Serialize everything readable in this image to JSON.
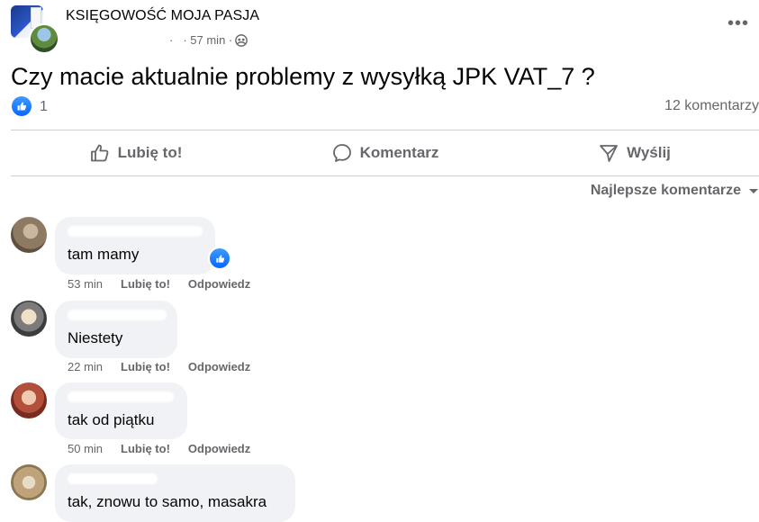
{
  "post": {
    "group_name": "KSIĘGOWOŚĆ MOJA PASJA",
    "author_dot": "·",
    "time": "· 57 min ·",
    "more_label": "•••",
    "text": "Czy macie aktualnie problemy z wysyłką JPK VAT_7 ?",
    "reaction_count": "1",
    "comments_count": "12 komentarzy"
  },
  "actions": {
    "like": "Lubię to!",
    "comment": "Komentarz",
    "send": "Wyślij"
  },
  "sort": {
    "label": "Najlepsze komentarze"
  },
  "comments": [
    {
      "text": "tam mamy",
      "time": "53 min",
      "like": "Lubię to!",
      "reply": "Odpowiedz",
      "liked": true
    },
    {
      "text": "Niestety",
      "time": "22 min",
      "like": "Lubię to!",
      "reply": "Odpowiedz",
      "liked": false
    },
    {
      "text": "tak od piątku",
      "time": "50 min",
      "like": "Lubię to!",
      "reply": "Odpowiedz",
      "liked": false
    },
    {
      "text": "tak, znowu to samo, masakra",
      "time": "",
      "like": "",
      "reply": "",
      "liked": false
    }
  ],
  "colors": {
    "accent": "#0866ff",
    "secondary_text": "#65676b",
    "bubble": "#f0f2f5",
    "divider": "#ced0d4"
  },
  "icons": {
    "privacy": "group-privacy-icon",
    "like": "thumbs-up-icon",
    "comment": "comment-bubble-icon",
    "send": "send-icon",
    "sort": "caret-down-icon"
  }
}
